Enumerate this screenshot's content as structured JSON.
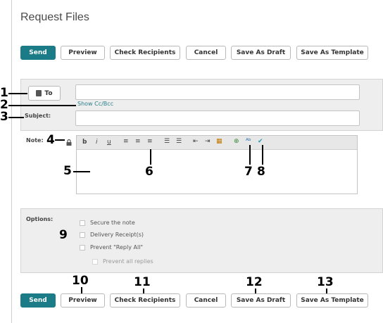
{
  "page": {
    "title": "Request Files"
  },
  "toolbar": {
    "send": "Send",
    "preview": "Preview",
    "check_recipients": "Check Recipients",
    "cancel": "Cancel",
    "save_as_draft": "Save As Draft",
    "save_as_template": "Save As Template"
  },
  "form": {
    "to_label": "To",
    "show_cc_bcc": "Show Cc/Bcc",
    "subject_label": "Subject:",
    "note_label": "Note:"
  },
  "editor": {
    "bold": "b",
    "italic": "i",
    "underline": "u"
  },
  "options": {
    "label": "Options:",
    "items": [
      "Secure the note",
      "Delivery Receipt(s)",
      "Prevent \"Reply All\""
    ],
    "sub_item": "Prevent all replies"
  },
  "callouts": [
    "1",
    "2",
    "3",
    "4",
    "5",
    "6",
    "7",
    "8",
    "9",
    "10",
    "11",
    "12",
    "13"
  ],
  "colors": {
    "primary": "#1b7c87",
    "panel": "#eeeeee",
    "link": "#2a7f8a"
  }
}
